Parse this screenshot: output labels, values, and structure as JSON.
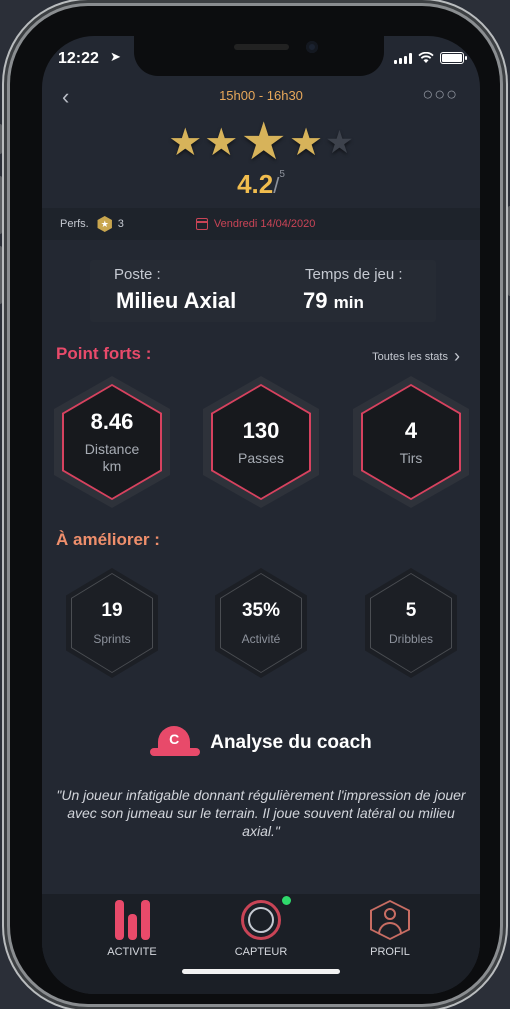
{
  "status": {
    "time": "12:22",
    "location_icon": "location-arrow-icon"
  },
  "header": {
    "time_range": "15h00 - 16h30",
    "back_icon": "chevron-left-icon",
    "more_icon": "more-dots-icon"
  },
  "rating": {
    "stars_filled": 4,
    "stars_total": 5,
    "value": "4.2",
    "max": "5"
  },
  "perf_bar": {
    "label": "Perfs.",
    "medal_count": "3",
    "date": "Vendredi 14/04/2020"
  },
  "position": {
    "poste_label": "Poste :",
    "poste_value": "Milieu Axial",
    "temps_label": "Temps de jeu :",
    "temps_value": "79",
    "temps_unit": "min"
  },
  "strong_points": {
    "title": "Point forts :",
    "all_stats_link": "Toutes les stats",
    "items": [
      {
        "value": "8.46",
        "label": "Distance km"
      },
      {
        "value": "130",
        "label": "Passes"
      },
      {
        "value": "4",
        "label": "Tirs"
      }
    ]
  },
  "improve": {
    "title": "À améliorer :",
    "items": [
      {
        "value": "19",
        "label": "Sprints"
      },
      {
        "value": "35%",
        "label": "Activité"
      },
      {
        "value": "5",
        "label": "Dribbles"
      }
    ]
  },
  "coach": {
    "title": "Analyse du coach",
    "icon_letter": "C",
    "quote": "\"Un joueur infatigable donnant régulièrement l'impression de jouer avec son jumeau sur le terrain. Il joue souvent latéral ou milieu axial.\""
  },
  "tabbar": {
    "items": [
      {
        "label": "ACTIVITE",
        "icon": "activity-bars-icon"
      },
      {
        "label": "CAPTEUR",
        "icon": "sensor-ring-icon"
      },
      {
        "label": "PROFIL",
        "icon": "profile-hex-icon"
      }
    ]
  },
  "colors": {
    "accent": "#e84a6a",
    "gold": "#f1bd4e",
    "improve": "#ef8f6c",
    "date": "#c94456"
  }
}
